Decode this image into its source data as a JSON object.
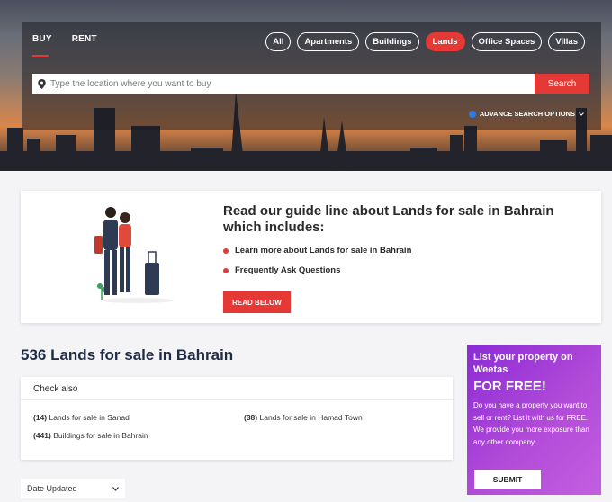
{
  "hero": {
    "tabs": [
      {
        "label": "BUY",
        "active": true
      },
      {
        "label": "RENT",
        "active": false
      }
    ],
    "categories": [
      {
        "label": "All",
        "active": false
      },
      {
        "label": "Apartments",
        "active": false
      },
      {
        "label": "Buildings",
        "active": false
      },
      {
        "label": "Lands",
        "active": true
      },
      {
        "label": "Office Spaces",
        "active": false
      },
      {
        "label": "Villas",
        "active": false
      }
    ],
    "search": {
      "placeholder": "Type the location where you want to buy",
      "value": "",
      "button_label": "Search"
    },
    "advance_search_label": "ADVANCE SEARCH OPTIONS"
  },
  "guide": {
    "title": "Read our guide line about Lands for sale in Bahrain which includes:",
    "items": [
      "Learn more about Lands for sale in Bahrain",
      "Frequently Ask Questions"
    ],
    "button_label": "READ BELOW"
  },
  "results": {
    "title": "536 Lands for sale in Bahrain"
  },
  "check_also": {
    "heading": "Check also",
    "links": [
      {
        "count": "(14)",
        "label": "Lands for sale in Sanad"
      },
      {
        "count": "(38)",
        "label": "Lands for sale in Hamad Town"
      },
      {
        "count": "(441)",
        "label": "Buildings for sale in Bahrain"
      }
    ]
  },
  "sort": {
    "selected": "Date Updated"
  },
  "promo": {
    "title": "List your property on Weetas",
    "headline": "FOR FREE!",
    "body": "Do you have a property you want to sell or rent? List it with us for FREE. We provide you more exposure than any other company.",
    "button_label": "SUBMIT"
  },
  "colors": {
    "accent": "#e53935",
    "promo": "#9b36d8",
    "title_text": "#1f2a44"
  },
  "icons": [
    "location-pin-icon",
    "info-icon",
    "chevron-down-icon"
  ]
}
